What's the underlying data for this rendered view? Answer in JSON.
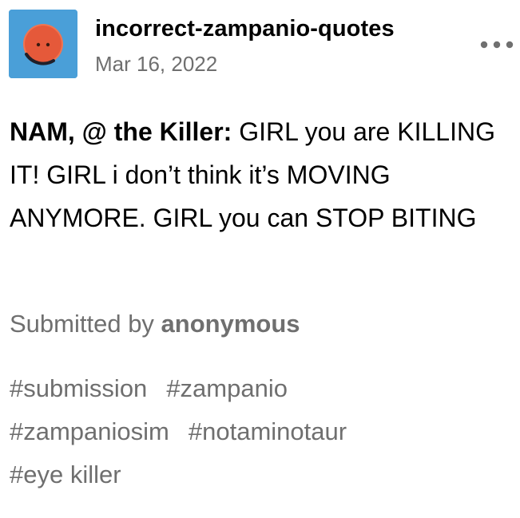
{
  "post": {
    "blog_name": "incorrect-zampanio-quotes",
    "date": "Mar 16, 2022",
    "avatar_icon": "orange-face-avatar-icon",
    "more_icon": "more-options-icon",
    "colors": {
      "avatar_bg": "#4a9fd8",
      "avatar_face": "#e5593a",
      "secondary_text": "#6f6f6f"
    },
    "quote": {
      "speaker": "NAM, @ the Killer:",
      "text": " GIRL you are KILLING IT! GIRL i don’t think it’s MOVING ANYMORE. GIRL you can STOP BITING"
    },
    "submitted": {
      "prefix": "Submitted by ",
      "user": "anonymous"
    },
    "tags": [
      "#submission",
      "#zampanio",
      "#zampaniosim",
      "#notaminotaur",
      "#eye killer"
    ]
  }
}
